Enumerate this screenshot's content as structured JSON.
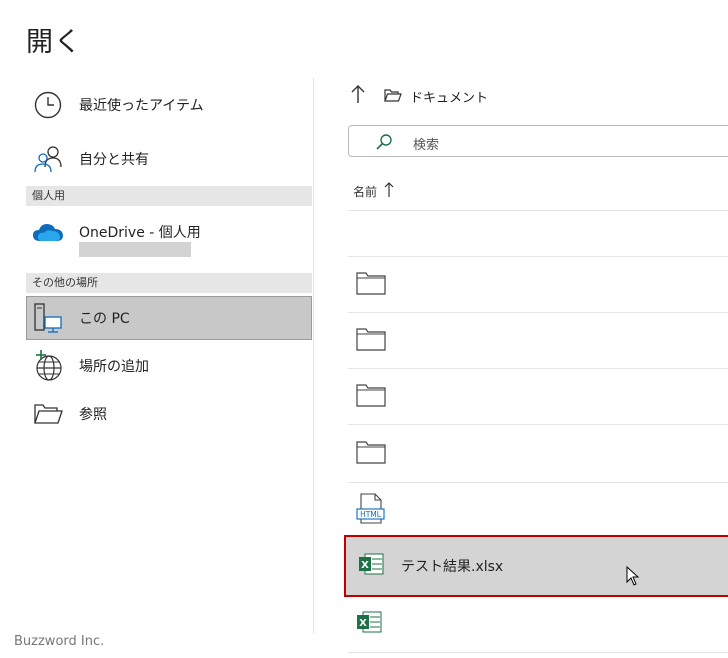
{
  "dialog": {
    "title": "開く"
  },
  "nav": {
    "recent": "最近使ったアイテム",
    "shared": "自分と共有",
    "personal_header": "個人用",
    "onedrive": "OneDrive - 個人用",
    "other_header": "その他の場所",
    "this_pc": "この PC",
    "add_place": "場所の追加",
    "browse": "参照"
  },
  "breadcrumb": {
    "label": "ドキュメント"
  },
  "search": {
    "placeholder": "検索"
  },
  "list": {
    "column_name": "名前",
    "sort_icon": "sort-ascending-arrow",
    "files": [
      {
        "type": "folder",
        "name": ""
      },
      {
        "type": "folder",
        "name": ""
      },
      {
        "type": "folder",
        "name": ""
      },
      {
        "type": "folder",
        "name": ""
      },
      {
        "type": "html",
        "name": ""
      },
      {
        "type": "excel",
        "name": "テスト結果.xlsx",
        "selected": true
      },
      {
        "type": "excel",
        "name": ""
      }
    ],
    "html_badge": "HTML"
  },
  "colors": {
    "accent_red": "#c00000",
    "excel_green": "#1e7145",
    "onedrive_blue": "#0f6cbd"
  },
  "watermark": "Buzzword Inc."
}
